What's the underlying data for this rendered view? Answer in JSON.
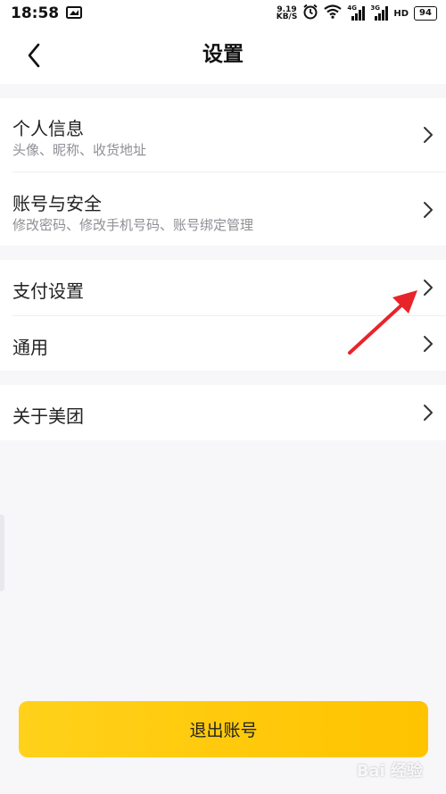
{
  "status_bar": {
    "time": "18:58",
    "net_speed_value": "9.19",
    "net_speed_unit": "KB/S",
    "sim1_tag": "4G",
    "sim2_tag": "3G",
    "hd_label": "HD",
    "battery": "94"
  },
  "nav": {
    "title": "设置"
  },
  "settings": {
    "profile": {
      "title": "个人信息",
      "subtitle": "头像、昵称、收货地址"
    },
    "account": {
      "title": "账号与安全",
      "subtitle": "修改密码、修改手机号码、账号绑定管理"
    },
    "payment": {
      "title": "支付设置"
    },
    "general": {
      "title": "通用"
    },
    "about": {
      "title": "关于美团"
    }
  },
  "logout": {
    "label": "退出账号"
  },
  "watermark": {
    "text": "Bai 经验"
  },
  "colors": {
    "background": "#f7f6f9",
    "button": "#ffc300",
    "annotation_arrow": "#e8242b"
  }
}
